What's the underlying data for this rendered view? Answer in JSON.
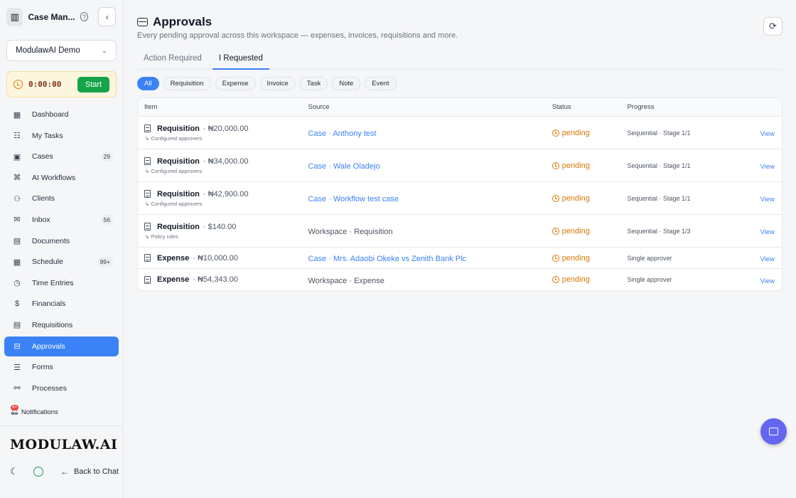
{
  "app": {
    "title": "Case Man...",
    "help_icon": "help-circle-icon",
    "collapse_icon": "chevron-left-icon"
  },
  "workspace": {
    "selected": "ModulawAI Demo"
  },
  "timer": {
    "value": "0:00:00",
    "start_label": "Start"
  },
  "sidebar": {
    "items": [
      {
        "label": "Dashboard",
        "icon": "grid-icon",
        "glyph": "▦",
        "count": ""
      },
      {
        "label": "My Tasks",
        "icon": "checklist-icon",
        "glyph": "☷",
        "count": ""
      },
      {
        "label": "Cases",
        "icon": "briefcase-icon",
        "glyph": "▣",
        "count": "29"
      },
      {
        "label": "AI Workflows",
        "icon": "bot-icon",
        "glyph": "⌘",
        "count": ""
      },
      {
        "label": "Clients",
        "icon": "users-icon",
        "glyph": "⚇",
        "count": ""
      },
      {
        "label": "Inbox",
        "icon": "mail-icon",
        "glyph": "✉",
        "count": "56"
      },
      {
        "label": "Documents",
        "icon": "file-icon",
        "glyph": "▤",
        "count": ""
      },
      {
        "label": "Schedule",
        "icon": "calendar-icon",
        "glyph": "▦",
        "count": "99+"
      },
      {
        "label": "Time Entries",
        "icon": "clock-icon",
        "glyph": "◷",
        "count": ""
      },
      {
        "label": "Financials",
        "icon": "dollar-icon",
        "glyph": "$",
        "count": ""
      },
      {
        "label": "Requisitions",
        "icon": "receipt-icon",
        "glyph": "▤",
        "count": ""
      },
      {
        "label": "Approvals",
        "icon": "inbox-icon",
        "glyph": "⊟",
        "count": ""
      },
      {
        "label": "Forms",
        "icon": "form-icon",
        "glyph": "☰",
        "count": ""
      },
      {
        "label": "Processes",
        "icon": "workflow-icon",
        "glyph": "⚯",
        "count": ""
      }
    ],
    "notifications_label": "Notifications",
    "notifications_badge": "9+",
    "brand": "MODULAW.AI",
    "back_label": "Back to Chat"
  },
  "page": {
    "title": "Approvals",
    "subtitle": "Every pending approval across this workspace — expenses, invoices, requisitions and more."
  },
  "tabs": [
    {
      "label": "Action Required",
      "active": false
    },
    {
      "label": "I Requested",
      "active": true
    }
  ],
  "filters": [
    {
      "label": "All",
      "active": true
    },
    {
      "label": "Requisition",
      "active": false
    },
    {
      "label": "Expense",
      "active": false
    },
    {
      "label": "Invoice",
      "active": false
    },
    {
      "label": "Task",
      "active": false
    },
    {
      "label": "Note",
      "active": false
    },
    {
      "label": "Event",
      "active": false
    }
  ],
  "table": {
    "headers": {
      "item": "Item",
      "source": "Source",
      "status": "Status",
      "progress": "Progress"
    },
    "rows": [
      {
        "type": "Requisition",
        "amount": "· ₦20,000.00",
        "sub": "↳ Configured approvers",
        "source": "Case · Anthony test",
        "source_link": true,
        "status": "pending",
        "progress": "Sequential · Stage 1/1",
        "action": "View"
      },
      {
        "type": "Requisition",
        "amount": "· ₦34,000.00",
        "sub": "↳ Configured approvers",
        "source": "Case · Wale Oladejo",
        "source_link": true,
        "status": "pending",
        "progress": "Sequential · Stage 1/1",
        "action": "View"
      },
      {
        "type": "Requisition",
        "amount": "· ₦42,900.00",
        "sub": "↳ Configured approvers",
        "source": "Case · Workflow test case",
        "source_link": true,
        "status": "pending",
        "progress": "Sequential · Stage 1/1",
        "action": "View"
      },
      {
        "type": "Requisition",
        "amount": "· $140.00",
        "sub": "↳ Policy roles",
        "source": "Workspace · Requisition",
        "source_link": false,
        "status": "pending",
        "progress": "Sequential · Stage 1/3",
        "action": "View"
      },
      {
        "type": "Expense",
        "amount": "· ₦10,000.00",
        "sub": "",
        "source": "Case · Mrs. Adaobi Okeke vs Zenith Bank Plc",
        "source_link": true,
        "status": "pending",
        "progress": "Single approver",
        "action": "View"
      },
      {
        "type": "Expense",
        "amount": "· ₦54,343.00",
        "sub": "",
        "source": "Workspace · Expense",
        "source_link": false,
        "status": "pending",
        "progress": "Single approver",
        "action": "View"
      }
    ]
  },
  "colors": {
    "accent": "#3b82f6",
    "pending": "#d97706",
    "start": "#16a34a",
    "fab": "#6366f1"
  }
}
